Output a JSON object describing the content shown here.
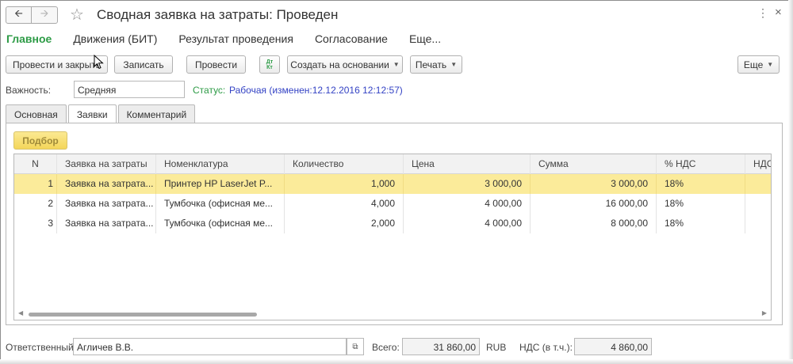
{
  "window": {
    "title": "Сводная заявка на затраты: Проведен",
    "more_glyph": "⋮",
    "close_glyph": "×"
  },
  "sections": [
    "Главное",
    "Движения (БИТ)",
    "Результат проведения",
    "Согласование",
    "Еще..."
  ],
  "toolbar": {
    "post_close": "Провести и закрыть",
    "save": "Записать",
    "post": "Провести",
    "dt_kt": "Дт Кт",
    "create_based": "Создать на основании",
    "print": "Печать",
    "more": "Еще"
  },
  "form": {
    "importance_label": "Важность:",
    "importance_value": "Средняя",
    "status_label": "Статус:",
    "status_value": "Рабочая (изменен:12.12.2016 12:12:57)"
  },
  "tabs": [
    "Основная",
    "Заявки",
    "Комментарий"
  ],
  "pick_button": "Подбор",
  "table": {
    "columns": [
      "N",
      "Заявка на затраты",
      "Номенклатура",
      "Количество",
      "Цена",
      "Сумма",
      "% НДС",
      "НДС"
    ],
    "rows": [
      {
        "n": "1",
        "request": "Заявка на затрата...",
        "item": "Принтер HP LaserJet P...",
        "qty": "1,000",
        "price": "3 000,00",
        "sum": "3 000,00",
        "vat_rate": "18%"
      },
      {
        "n": "2",
        "request": "Заявка на затрата...",
        "item": "Тумбочка (офисная ме...",
        "qty": "4,000",
        "price": "4 000,00",
        "sum": "16 000,00",
        "vat_rate": "18%"
      },
      {
        "n": "3",
        "request": "Заявка на затрата...",
        "item": "Тумбочка (офисная ме...",
        "qty": "2,000",
        "price": "4 000,00",
        "sum": "8 000,00",
        "vat_rate": "18%"
      }
    ]
  },
  "footer": {
    "responsible_label": "Ответственный:",
    "responsible_value": "Агличев В.В.",
    "total_label": "Всего:",
    "total_value": "31 860,00",
    "currency": "RUB",
    "vat_label": "НДС (в т.ч.):",
    "vat_value": "4 860,00"
  },
  "colors": {
    "accent_green": "#2d9b46",
    "status_blue": "#3342c4",
    "selected_row": "#fbeb9a",
    "pick_button": "#f4d65a"
  }
}
